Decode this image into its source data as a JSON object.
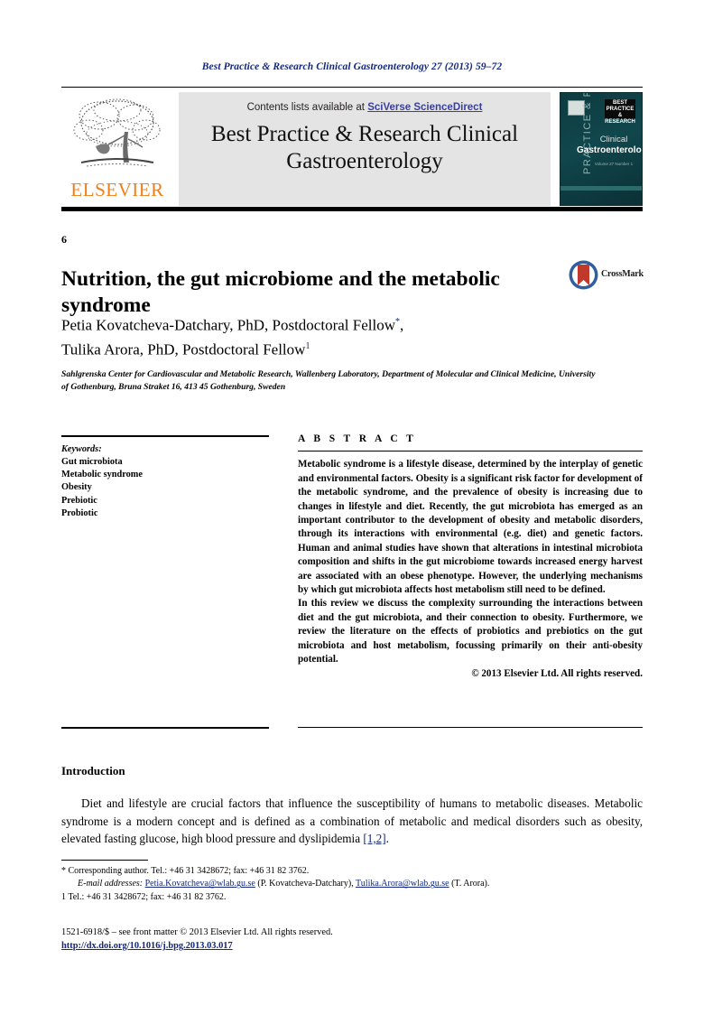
{
  "running_head": "Best Practice & Research Clinical Gastroenterology 27 (2013) 59–72",
  "masthead": {
    "publisher_logo_label": "ELSEVIER",
    "contents_prefix": "Contents lists available at ",
    "contents_link": "SciVerse ScienceDirect",
    "journal_title": "Best Practice & Research Clinical Gastroenterology",
    "cover": {
      "vertical_text": "PRACTICE & RESEARCH",
      "badge_text": "BEST PRACTICE & RESEARCH",
      "title_line1": "Clinical",
      "title_line2": "Gastroenterology",
      "subtitle": "Volume 27 Number 1"
    }
  },
  "article": {
    "number": "6",
    "title": "Nutrition, the gut microbiome and the metabolic syndrome",
    "crossmark_label": "CrossMark",
    "author1": "Petia Kovatcheva-Datchary, PhD, Postdoctoral Fellow",
    "author1_marker": "*",
    "author2": "Tulika Arora, PhD, Postdoctoral Fellow",
    "author2_marker": "1",
    "affiliation": "Sahlgrenska Center for Cardiovascular and Metabolic Research, Wallenberg Laboratory, Department of Molecular and Clinical Medicine, University of Gothenburg, Bruna Straket 16, 413 45 Gothenburg, Sweden"
  },
  "keywords": {
    "label": "Keywords:",
    "items": [
      "Gut microbiota",
      "Metabolic syndrome",
      "Obesity",
      "Prebiotic",
      "Probiotic"
    ]
  },
  "abstract": {
    "heading": "A B S T R A C T",
    "paragraph1": "Metabolic syndrome is a lifestyle disease, determined by the interplay of genetic and environmental factors. Obesity is a significant risk factor for development of the metabolic syndrome, and the prevalence of obesity is increasing due to changes in lifestyle and diet. Recently, the gut microbiota has emerged as an important contributor to the development of obesity and metabolic disorders, through its interactions with environmental (e.g. diet) and genetic factors. Human and animal studies have shown that alterations in intestinal microbiota composition and shifts in the gut microbiome towards increased energy harvest are associated with an obese phenotype. However, the underlying mechanisms by which gut microbiota affects host metabolism still need to be defined.",
    "paragraph2": "In this review we discuss the complexity surrounding the interactions between diet and the gut microbiota, and their connection to obesity. Furthermore, we review the literature on the effects of probiotics and prebiotics on the gut microbiota and host metabolism, focussing primarily on their anti-obesity potential.",
    "copyright": "© 2013 Elsevier Ltd. All rights reserved."
  },
  "introduction": {
    "heading": "Introduction",
    "text_before_cite": "Diet and lifestyle are crucial factors that influence the susceptibility of humans to metabolic diseases. Metabolic syndrome is a modern concept and is defined as a combination of metabolic and medical disorders such as obesity, elevated fasting glucose, high blood pressure and dyslipidemia ",
    "citation": "[1,2]",
    "text_after_cite": "."
  },
  "footnotes": {
    "corresponding": "* Corresponding author. Tel.: +46 31 3428672; fax: +46 31 82 3762.",
    "email_label": "E-mail addresses:",
    "email1": "Petia.Kovatcheva@wlab.gu.se",
    "email1_owner": " (P. Kovatcheva-Datchary), ",
    "email2": "Tulika.Arora@wlab.gu.se",
    "email2_owner": " (T. Arora).",
    "note1": "1  Tel.: +46 31 3428672; fax: +46 31 82 3762."
  },
  "imprint": {
    "issn_line": "1521-6918/$ – see front matter © 2013 Elsevier Ltd. All rights reserved.",
    "doi": "http://dx.doi.org/10.1016/j.bpg.2013.03.017"
  },
  "colors": {
    "journal_blue": "#12277d",
    "elsevier_orange": "#f07f1a",
    "link_blue": "#3b3fa0",
    "cover_teal": "#0e3b40"
  }
}
